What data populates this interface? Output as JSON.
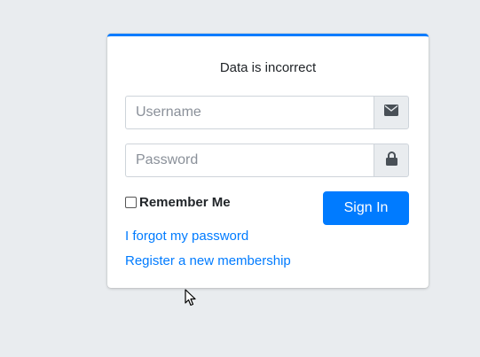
{
  "login": {
    "message": "Data is incorrect",
    "username_placeholder": "Username",
    "password_placeholder": "Password",
    "remember_label": "Remember Me",
    "signin_label": "Sign In",
    "forgot_link": "I forgot my password",
    "register_link": "Register a new membership"
  },
  "icons": {
    "username_icon": "envelope-icon",
    "password_icon": "lock-icon"
  },
  "colors": {
    "accent": "#007bff",
    "background": "#e9ecef",
    "card": "#ffffff"
  }
}
